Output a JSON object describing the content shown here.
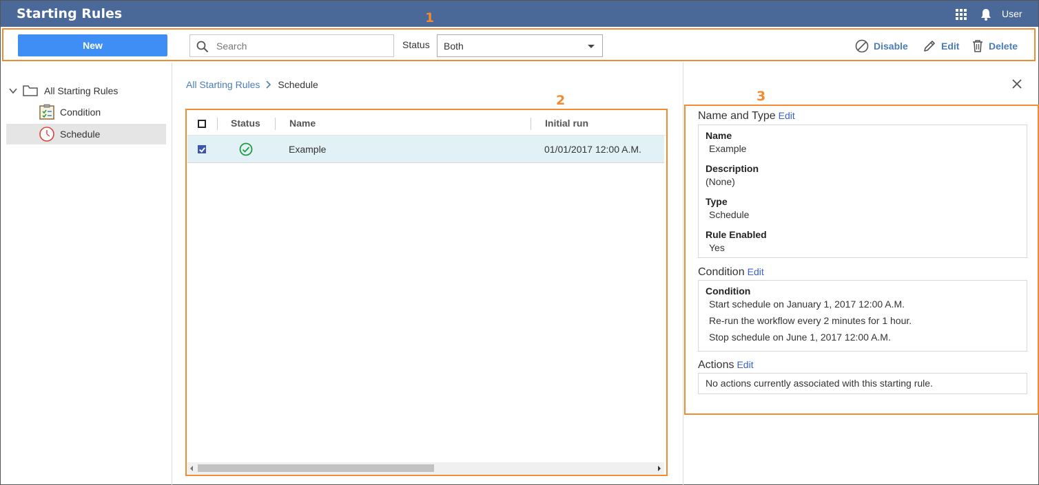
{
  "app": {
    "title": "Starting Rules",
    "user_label": "User",
    "brand_color": "#4a6898"
  },
  "toolbar": {
    "new_label": "New",
    "search_placeholder": "Search",
    "status_label": "Status",
    "status_value": "Both",
    "disable_label": "Disable",
    "edit_label": "Edit",
    "delete_label": "Delete"
  },
  "callouts": [
    "1",
    "2",
    "3"
  ],
  "sidebar": {
    "root_label": "All Starting Rules",
    "items": [
      {
        "label": "Condition",
        "icon": "checklist-icon",
        "selected": false
      },
      {
        "label": "Schedule",
        "icon": "clock-icon",
        "selected": true
      }
    ]
  },
  "breadcrumb": {
    "root": "All Starting Rules",
    "current": "Schedule"
  },
  "grid": {
    "columns": [
      "Status",
      "Name",
      "Initial run"
    ],
    "rows": [
      {
        "checked": true,
        "status_icon": "check-circle-icon",
        "name": "Example",
        "initial_run": "01/01/2017 12:00 A.M."
      }
    ]
  },
  "detail": {
    "name_type": {
      "title": "Name and Type",
      "edit": "Edit",
      "fields": [
        {
          "label": "Name",
          "value": "Example"
        },
        {
          "label": "Description",
          "value": "(None)"
        },
        {
          "label": "Type",
          "value": "Schedule"
        },
        {
          "label": "Rule Enabled",
          "value": "Yes"
        }
      ]
    },
    "condition": {
      "title": "Condition",
      "edit": "Edit",
      "label": "Condition",
      "lines": [
        "Start schedule on January 1, 2017 12:00 A.M.",
        "Re-run the workflow every 2 minutes for 1 hour.",
        "Stop schedule on June 1, 2017 12:00 A.M."
      ]
    },
    "actions": {
      "title": "Actions",
      "edit": "Edit",
      "text": "No actions currently associated with this starting rule."
    }
  }
}
